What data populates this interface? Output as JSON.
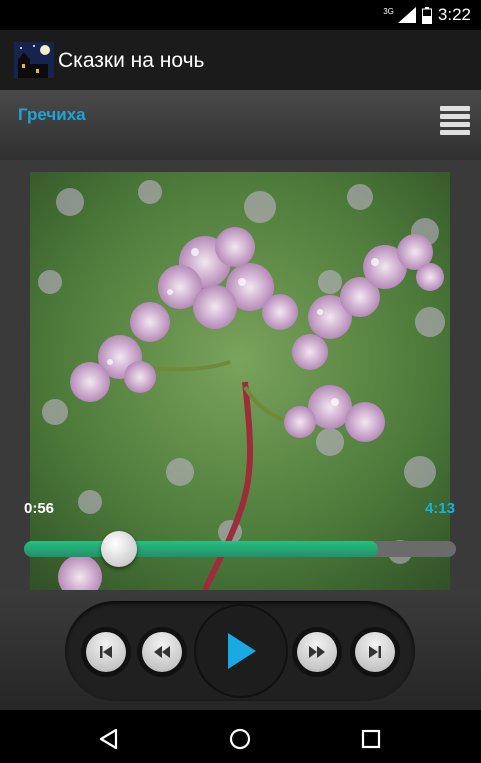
{
  "status_bar": {
    "network": "3G",
    "time": "3:22"
  },
  "app_bar": {
    "title": "Сказки на ночь"
  },
  "player": {
    "track_title": "Гречиха",
    "elapsed": "0:56",
    "duration": "4:13",
    "progress_fraction": 0.22,
    "buffered_fraction": 0.82
  },
  "icons": {
    "menu": "hamburger-menu-icon",
    "prev": "skip-previous-icon",
    "rewind": "rewind-icon",
    "play": "play-icon",
    "forward": "fast-forward-icon",
    "next": "skip-next-icon",
    "back": "back-triangle-icon",
    "home": "home-circle-icon",
    "recents": "recents-square-icon"
  },
  "colors": {
    "accent": "#1fa4d6",
    "progress": "#25b37a",
    "total_time": "#17b2d8"
  }
}
